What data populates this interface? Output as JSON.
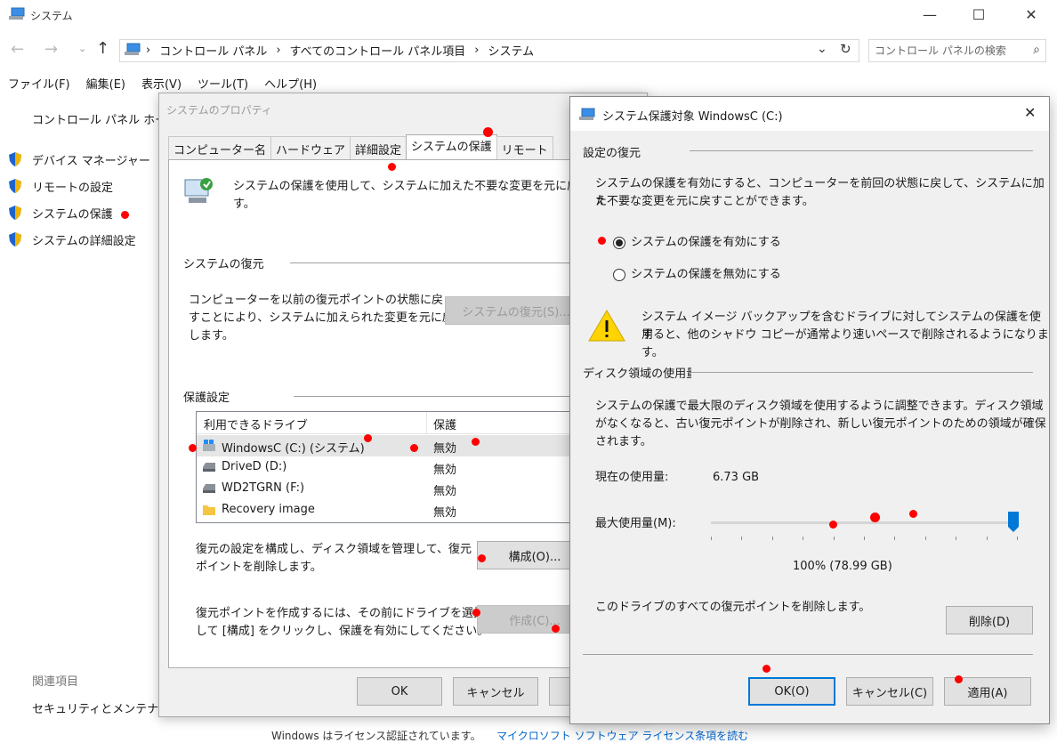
{
  "window": {
    "title": "システム",
    "search_placeholder": "コントロール パネルの検索",
    "breadcrumbs": [
      "コントロール パネル",
      "すべてのコントロール パネル項目",
      "システム"
    ],
    "menu": [
      "ファイル(F)",
      "編集(E)",
      "表示(V)",
      "ツール(T)",
      "ヘルプ(H)"
    ]
  },
  "sidebar": {
    "home": "コントロール パネル ホーム",
    "items": [
      "デバイス マネージャー",
      "リモートの設定",
      "システムの保護",
      "システムの詳細設定"
    ],
    "related_title": "関連項目",
    "related": [
      "セキュリティとメンテナンス"
    ]
  },
  "footer": {
    "text": "Windows はライセンス認証されています。",
    "link": "マイクロソフト ソフトウェア ライセンス条項を読む"
  },
  "sysprops": {
    "title": "システムのプロパティ",
    "tabs": [
      "コンピューター名",
      "ハードウェア",
      "詳細設定",
      "システムの保護",
      "リモート"
    ],
    "intro": "システムの保護を使用して、システムに加えた不要な変更を元に戻",
    "intro2": "す。",
    "restore_title": "システムの復元",
    "restore_text": [
      "コンピューターを以前の復元ポイントの状態に戻",
      "すことにより、システムに加えられた変更を元に戻",
      "します。"
    ],
    "restore_button": "システムの復元(S)...",
    "protect_title": "保護設定",
    "col_drive": "利用できるドライブ",
    "col_protect": "保護",
    "drives": [
      {
        "name": "WindowsC (C:) (システム)",
        "status": "無効"
      },
      {
        "name": "DriveD (D:)",
        "status": "無効"
      },
      {
        "name": "WD2TGRN (F:)",
        "status": "無効"
      },
      {
        "name": "Recovery image",
        "status": "無効"
      }
    ],
    "configure_text": [
      "復元の設定を構成し、ディスク領域を管理して、復元",
      "ポイントを削除します。"
    ],
    "configure_button": "構成(O)...",
    "create_text": [
      "復元ポイントを作成するには、その前にドライブを選択",
      "して [構成] をクリックし、保護を有効にしてください。"
    ],
    "create_button": "作成(C)...",
    "ok": "OK",
    "cancel": "キャンセル"
  },
  "protect": {
    "title": "システム保護対象 WindowsC (C:)",
    "restore_settings": "設定の復元",
    "restore_desc": [
      "システムの保護を有効にすると、コンピューターを前回の状態に戻して、システムに加え",
      "た不要な変更を元に戻すことができます。"
    ],
    "radio_on": "システムの保護を有効にする",
    "radio_off": "システムの保護を無効にする",
    "radio_selected": "on",
    "warning": [
      "システム イメージ バックアップを含むドライブに対してシステムの保護を使用",
      "すると、他のシャドウ コピーが通常より速いペースで削除されるようになりま",
      "す。"
    ],
    "disk_title": "ディスク領域の使用量",
    "disk_desc": [
      "システムの保護で最大限のディスク領域を使用するように調整できます。ディスク領域",
      "がなくなると、古い復元ポイントが削除され、新しい復元ポイントのための領域が確保",
      "されます。"
    ],
    "current_label": "現在の使用量:",
    "current_value": "6.73 GB",
    "max_label": "最大使用量(M):",
    "max_value": "100% (78.99 GB)",
    "max_fraction": 1.0,
    "delete_text": "このドライブのすべての復元ポイントを削除します。",
    "delete_button": "削除(D)",
    "ok": "OK(O)",
    "cancel": "キャンセル(C)",
    "apply": "適用(A)"
  },
  "colors": {
    "accent": "#0078d7",
    "marker": "#ff0000",
    "warning": "#ffd400"
  }
}
